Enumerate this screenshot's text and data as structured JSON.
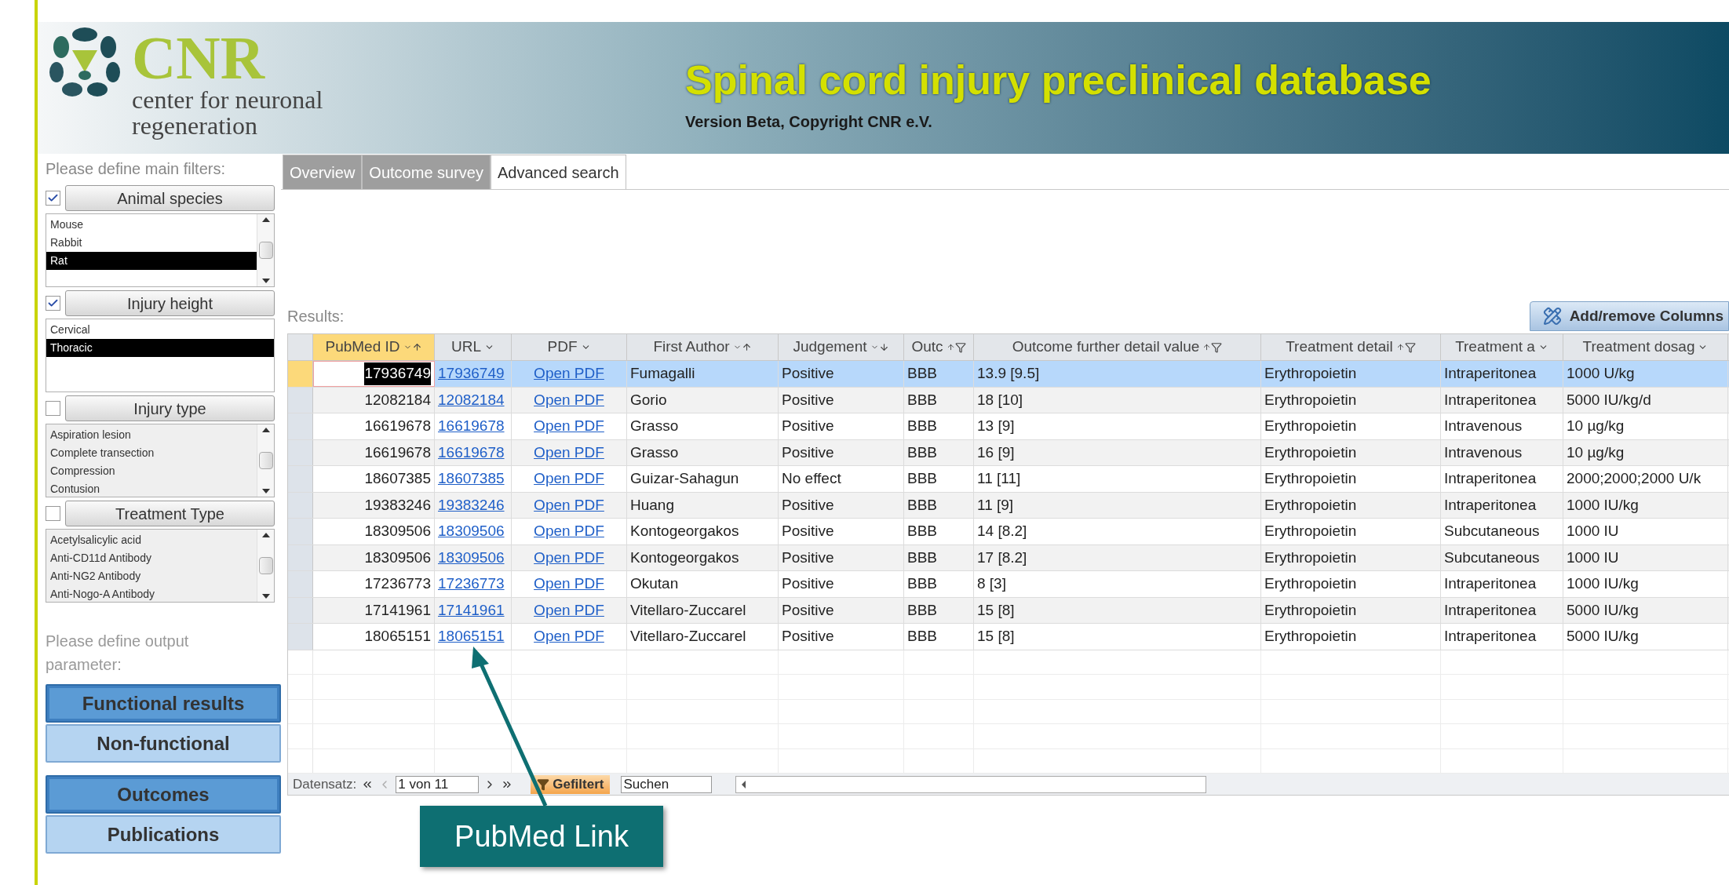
{
  "header": {
    "logo_text": "CNR",
    "logo_subtitle_1": "center for neuronal",
    "logo_subtitle_2": "regeneration",
    "title": "Spinal cord injury preclinical database",
    "version": "Version Beta, Copyright CNR e.V."
  },
  "filters_label": "Please define main filters:",
  "filters": [
    {
      "label": "Animal species",
      "checked": true,
      "scrollable": true,
      "items": [
        {
          "label": "Mouse",
          "selected": false
        },
        {
          "label": "Rabbit",
          "selected": false
        },
        {
          "label": "Rat",
          "selected": true
        }
      ]
    },
    {
      "label": "Injury height",
      "checked": true,
      "scrollable": false,
      "items": [
        {
          "label": "Cervical",
          "selected": false
        },
        {
          "label": "Thoracic",
          "selected": true
        }
      ]
    },
    {
      "label": "Injury type",
      "checked": false,
      "scrollable": true,
      "items": [
        {
          "label": "Aspiration lesion",
          "selected": false
        },
        {
          "label": "Complete transection",
          "selected": false
        },
        {
          "label": "Compression",
          "selected": false
        },
        {
          "label": "Contusion",
          "selected": false
        }
      ]
    },
    {
      "label": "Treatment Type",
      "checked": false,
      "scrollable": true,
      "items": [
        {
          "label": "Acetylsalicylic acid",
          "selected": false
        },
        {
          "label": "Anti-CD11d Antibody",
          "selected": false
        },
        {
          "label": "Anti-NG2 Antibody",
          "selected": false
        },
        {
          "label": "Anti-Nogo-A Antibody",
          "selected": false
        }
      ]
    }
  ],
  "output_label": "Please define output parameter:",
  "output_groups": [
    [
      {
        "label": "Functional results",
        "selected": true
      },
      {
        "label": "Non-functional",
        "selected": false
      }
    ],
    [
      {
        "label": "Outcomes",
        "selected": true
      },
      {
        "label": "Publications",
        "selected": false
      }
    ]
  ],
  "tabs": [
    {
      "label": "Overview",
      "selected": false
    },
    {
      "label": "Outcome survey",
      "selected": false
    },
    {
      "label": "Advanced search",
      "selected": true
    }
  ],
  "results_label": "Results:",
  "add_columns_button": "Add/remove Columns",
  "table": {
    "columns": [
      {
        "label": "PubMed ID",
        "kind": "number",
        "selected": true
      },
      {
        "label": "URL",
        "kind": "link",
        "selected": false
      },
      {
        "label": "PDF",
        "kind": "link",
        "selected": false
      },
      {
        "label": "First Author",
        "kind": "text",
        "selected": false
      },
      {
        "label": "Judgement",
        "kind": "text",
        "selected": false
      },
      {
        "label": "Outc",
        "kind": "text",
        "selected": false
      },
      {
        "label": "Outcome further detail value",
        "kind": "text",
        "selected": false
      },
      {
        "label": "Treatment detail",
        "kind": "text",
        "selected": false
      },
      {
        "label": "Treatment a",
        "kind": "text",
        "selected": false
      },
      {
        "label": "Treatment  dosag",
        "kind": "text",
        "selected": false
      }
    ],
    "rows": [
      {
        "selected": true,
        "cells": [
          "17936749",
          "17936749",
          "Open PDF",
          "Fumagalli",
          "Positive",
          "BBB",
          "13.9 [9.5]",
          "Erythropoietin",
          "Intraperitonea",
          "1000 U/kg"
        ]
      },
      {
        "selected": false,
        "cells": [
          "12082184",
          "12082184",
          "Open PDF",
          "Gorio",
          "Positive",
          "BBB",
          "18 [10]",
          "Erythropoietin",
          "Intraperitonea",
          "5000 IU/kg/d"
        ]
      },
      {
        "selected": false,
        "cells": [
          "16619678",
          "16619678",
          "Open PDF",
          "Grasso",
          "Positive",
          "BBB",
          "13 [9]",
          "Erythropoietin",
          "Intravenous",
          "10 µg/kg"
        ]
      },
      {
        "selected": false,
        "cells": [
          "16619678",
          "16619678",
          "Open PDF",
          "Grasso",
          "Positive",
          "BBB",
          "16 [9]",
          "Erythropoietin",
          "Intravenous",
          "10 µg/kg"
        ]
      },
      {
        "selected": false,
        "cells": [
          "18607385",
          "18607385",
          "Open PDF",
          "Guizar-Sahagun",
          "No effect",
          "BBB",
          "11 [11]",
          "Erythropoietin",
          "Intraperitonea",
          "2000;2000;2000 U/k"
        ]
      },
      {
        "selected": false,
        "cells": [
          "19383246",
          "19383246",
          "Open PDF",
          "Huang",
          "Positive",
          "BBB",
          "11 [9]",
          "Erythropoietin",
          "Intraperitonea",
          "1000 IU/kg"
        ]
      },
      {
        "selected": false,
        "cells": [
          "18309506",
          "18309506",
          "Open PDF",
          "Kontogeorgakos",
          "Positive",
          "BBB",
          "14 [8.2]",
          "Erythropoietin",
          "Subcutaneous",
          "1000 IU"
        ]
      },
      {
        "selected": false,
        "cells": [
          "18309506",
          "18309506",
          "Open PDF",
          "Kontogeorgakos",
          "Positive",
          "BBB",
          "17 [8.2]",
          "Erythropoietin",
          "Subcutaneous",
          "1000 IU"
        ]
      },
      {
        "selected": false,
        "cells": [
          "17236773",
          "17236773",
          "Open PDF",
          "Okutan",
          "Positive",
          "BBB",
          "8 [3]",
          "Erythropoietin",
          "Intraperitonea",
          "1000 IU/kg"
        ]
      },
      {
        "selected": false,
        "cells": [
          "17141961",
          "17141961",
          "Open PDF",
          "Vitellaro-Zuccarel",
          "Positive",
          "BBB",
          "15 [8]",
          "Erythropoietin",
          "Intraperitonea",
          "5000 IU/kg"
        ]
      },
      {
        "selected": false,
        "cells": [
          "18065151",
          "18065151",
          "Open PDF",
          "Vitellaro-Zuccarel",
          "Positive",
          "BBB",
          "15 [8]",
          "Erythropoietin",
          "Intraperitonea",
          "5000 IU/kg"
        ]
      }
    ]
  },
  "navigation": {
    "label": "Datensatz:",
    "record": "1 von 11",
    "filter_button": "Gefiltert",
    "search": "Suchen"
  },
  "callout": {
    "text": "PubMed Link"
  }
}
